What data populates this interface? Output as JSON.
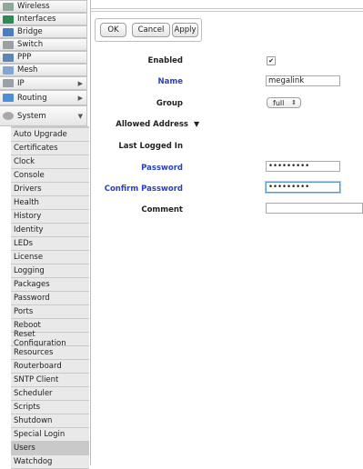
{
  "sidebar": {
    "menu": [
      {
        "label": "Wireless",
        "icon": "wireless-icon",
        "color": "#8fa89a",
        "arrow": ""
      },
      {
        "label": "Interfaces",
        "icon": "interfaces-icon",
        "color": "#2e8b57",
        "arrow": ""
      },
      {
        "label": "Bridge",
        "icon": "bridge-icon",
        "color": "#4a7ec4",
        "arrow": ""
      },
      {
        "label": "Switch",
        "icon": "switch-icon",
        "color": "#9aa0a6",
        "arrow": ""
      },
      {
        "label": "PPP",
        "icon": "ppp-icon",
        "color": "#5b86b8",
        "arrow": ""
      },
      {
        "label": "Mesh",
        "icon": "mesh-icon",
        "color": "#7fa6d6",
        "arrow": ""
      },
      {
        "label": "IP",
        "icon": "ip-icon",
        "color": "#9aa0a6",
        "arrow": "▶"
      },
      {
        "label": "Routing",
        "icon": "routing-icon",
        "color": "#4c8fd6",
        "arrow": "▶"
      },
      {
        "label": "System",
        "icon": "system-icon",
        "color": "#a9a9a9",
        "arrow": "▼"
      }
    ],
    "submenu": [
      "Auto Upgrade",
      "Certificates",
      "Clock",
      "Console",
      "Drivers",
      "Health",
      "History",
      "Identity",
      "LEDs",
      "License",
      "Logging",
      "Packages",
      "Password",
      "Ports",
      "Reboot",
      "Reset Configuration",
      "Resources",
      "Routerboard",
      "SNTP Client",
      "Scheduler",
      "Scripts",
      "Shutdown",
      "Special Login",
      "Users",
      "Watchdog"
    ],
    "active": "Users"
  },
  "toolbar": {
    "ok": "OK",
    "cancel": "Cancel",
    "apply": "Apply"
  },
  "form": {
    "enabled_label": "Enabled",
    "enabled_value": "✔",
    "name_label": "Name",
    "name_value": "megalink",
    "group_label": "Group",
    "group_value": "full",
    "allowed_address_label": "Allowed Address",
    "allowed_address_toggle": "▼",
    "last_logged_in_label": "Last Logged In",
    "password_label": "Password",
    "password_value": "•••••••••",
    "confirm_password_label": "Confirm Password",
    "confirm_password_value": "•••••••••",
    "comment_label": "Comment",
    "comment_value": ""
  }
}
